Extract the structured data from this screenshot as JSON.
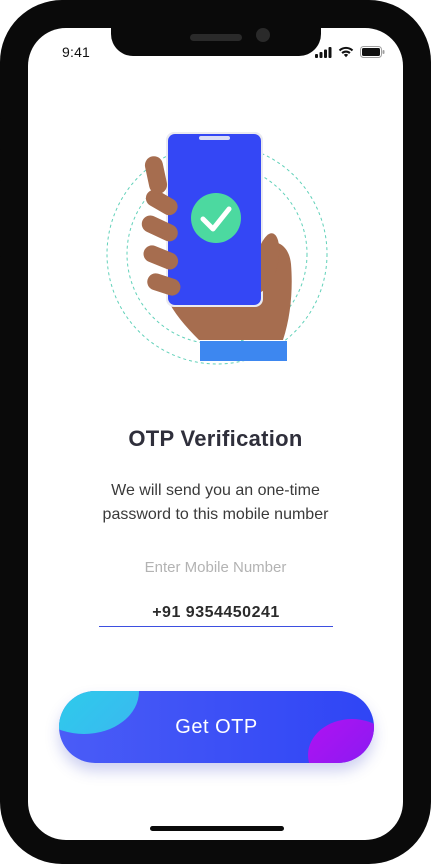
{
  "status_bar": {
    "time": "9:41"
  },
  "screen": {
    "title": "OTP Verification",
    "description_lines": [
      "We will send  you an one-time",
      "password to this mobile number"
    ],
    "phone_label": "Enter Mobile Number",
    "phone_value": "+91 9354450241",
    "button_label": "Get OTP"
  },
  "icons": {
    "signal": "cellular-signal-icon",
    "wifi": "wifi-icon",
    "battery": "battery-icon",
    "illustration": "hand-holding-phone-verified-illustration",
    "check": "check-icon"
  },
  "colors": {
    "accent_blue": "#3447f5",
    "check_green": "#4cd9a0",
    "blob_cyan": "#27d6e8",
    "blob_purple": "#a415f2",
    "underline": "#3d4fe0"
  }
}
